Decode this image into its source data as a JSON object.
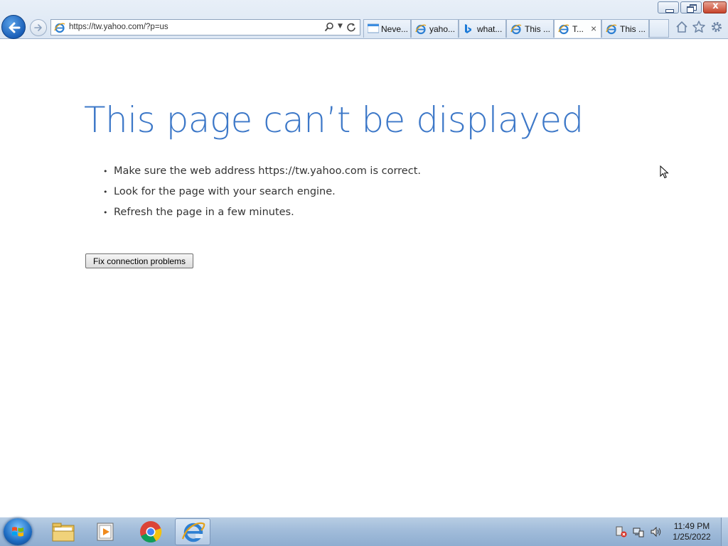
{
  "window": {
    "minimize_icon": "minimize-icon",
    "maximize_icon": "restore-icon",
    "close_icon": "close-icon",
    "close_glyph": "x"
  },
  "toolbar": {
    "back_icon": "back-arrow-icon",
    "forward_icon": "forward-arrow-icon",
    "address": "https://tw.yahoo.com/?p=us",
    "search_icon": "search-icon",
    "refresh_icon": "refresh-icon",
    "home_icon": "home-icon",
    "favorites_icon": "star-icon",
    "tools_icon": "gear-icon"
  },
  "tabs": [
    {
      "label": "Neve...",
      "icon": "tab-blank-icon"
    },
    {
      "label": "yaho...",
      "icon": "ie-icon"
    },
    {
      "label": "what...",
      "icon": "bing-icon"
    },
    {
      "label": "This ...",
      "icon": "ie-icon"
    },
    {
      "label": "T...",
      "icon": "ie-icon",
      "active": true,
      "close_glyph": "×"
    },
    {
      "label": "This ...",
      "icon": "ie-icon"
    }
  ],
  "page": {
    "title": "This page can’t be displayed",
    "bullet": "•",
    "suggestions": [
      "Make sure the web address https://tw.yahoo.com is correct.",
      "Look for the page with your search engine.",
      "Refresh the page in a few minutes."
    ],
    "fix_button": "Fix connection problems"
  },
  "taskbar": {
    "apps": [
      "windows-explorer",
      "media-player",
      "chrome",
      "internet-explorer"
    ],
    "active_app": "internet-explorer",
    "time": "11:49 PM",
    "date": "1/25/2022",
    "tray_icons": [
      "network-error-icon",
      "network-icon",
      "volume-icon"
    ]
  }
}
